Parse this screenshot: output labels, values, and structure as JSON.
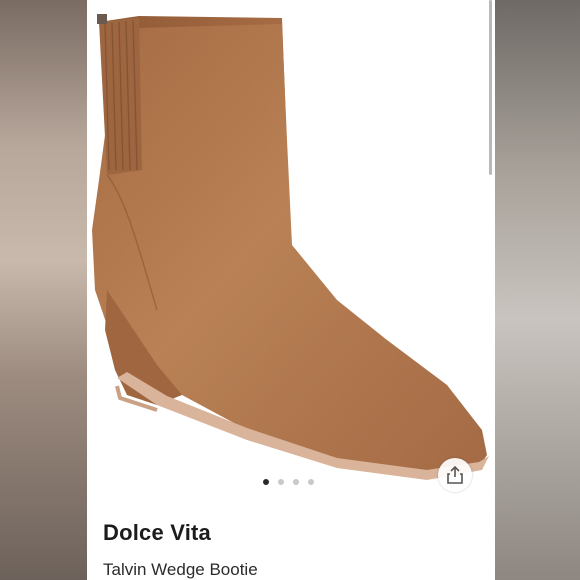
{
  "product": {
    "brand": "Dolce Vita",
    "name": "Talvin Wedge Bootie",
    "image_icon": "suede-wedge-ankle-boot",
    "color": "#b87c4f"
  },
  "carousel": {
    "total_images": 4,
    "active_index": 0
  },
  "actions": {
    "share_icon": "share-icon"
  },
  "colors": {
    "page_background": "#ffffff",
    "dot_active": "#2a2a2a",
    "dot_inactive": "#c9c9c9"
  }
}
